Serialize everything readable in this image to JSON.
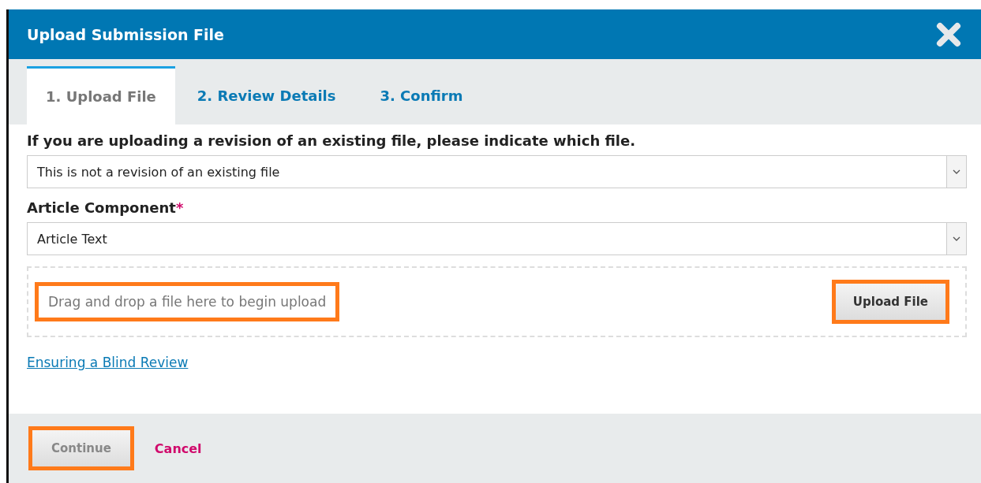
{
  "window": {
    "title": "Upload Submission File"
  },
  "tabs": [
    {
      "label": "1. Upload File",
      "selected": true
    },
    {
      "label": "2. Review Details",
      "selected": false
    },
    {
      "label": "3. Confirm",
      "selected": false
    }
  ],
  "fields": [
    {
      "label": "If you are uploading a revision of an existing file, please indicate which file.",
      "value": "This is not a revision of an existing file"
    },
    {
      "label": "Article Component",
      "required_mark": "*",
      "value": "Article Text"
    }
  ],
  "dropzone": {
    "text": "Drag and drop a file here to begin upload",
    "highlighted": true,
    "button": {
      "label": "Upload File",
      "highlighted": true
    }
  },
  "link": "Ensuring a Blind Review",
  "footer": {
    "continue": {
      "label": "Continue",
      "disabled": true,
      "highlighted": true
    },
    "cancel": "Cancel"
  }
}
